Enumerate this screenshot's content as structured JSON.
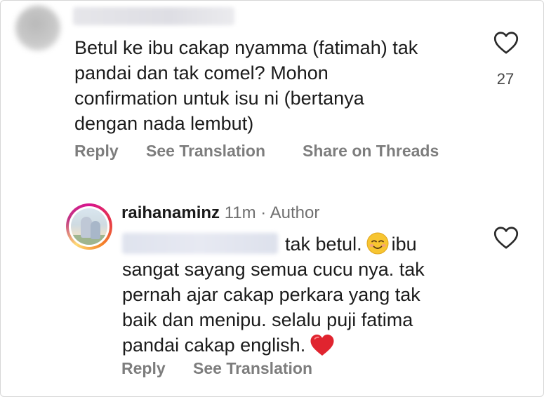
{
  "comment": {
    "text_lines": [
      "Betul ke ibu cakap nyamma (fatimah) tak",
      "pandai dan tak comel? Mohon",
      "confirmation untuk isu ni (bertanya",
      "dengan nada lembut)"
    ],
    "likes": "27",
    "actions": {
      "reply": "Reply",
      "see_translation": "See Translation",
      "share_on_threads": "Share on Threads"
    }
  },
  "reply": {
    "username": "raihanaminz",
    "time": "11m",
    "separator": "·",
    "role": "Author",
    "text_lines": [
      "tak betul.",
      "ibu",
      "sangat sayang semua cucu nya. tak",
      "pernah ajar cakap perkara yang tak",
      "baik dan menipu. selalu puji fatima",
      "pandai cakap english."
    ],
    "emojis": [
      "smiling-face-emoji",
      "red-heart-emoji"
    ],
    "actions": {
      "reply": "Reply",
      "see_translation": "See Translation"
    }
  },
  "colors": {
    "text": "#1b1b1b",
    "action_gray": "#7d7d7d",
    "meta_gray": "#6f6f6f",
    "heart_emoji": "#e0242f",
    "story_ring": "#d8148f"
  },
  "icons": {
    "like": "heart-outline-icon"
  }
}
